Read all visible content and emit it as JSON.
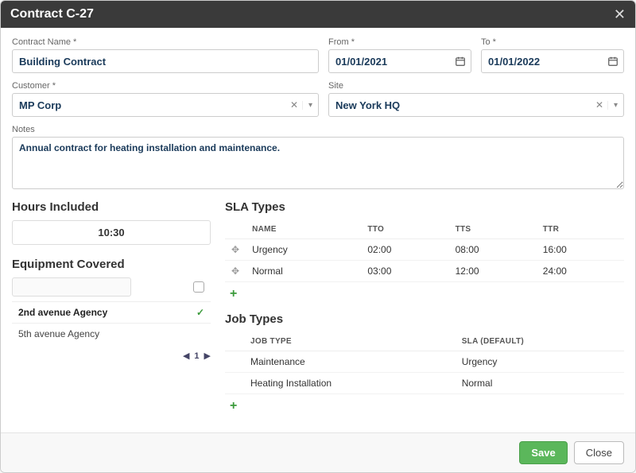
{
  "header": {
    "title": "Contract C-27"
  },
  "form": {
    "contract_name": {
      "label": "Contract Name *",
      "value": "Building Contract"
    },
    "from": {
      "label": "From *",
      "value": "01/01/2021"
    },
    "to": {
      "label": "To *",
      "value": "01/01/2022"
    },
    "customer": {
      "label": "Customer *",
      "value": "MP Corp"
    },
    "site": {
      "label": "Site",
      "value": "New York HQ"
    },
    "notes": {
      "label": "Notes",
      "value": "Annual contract for heating installation and maintenance."
    }
  },
  "hours": {
    "title": "Hours Included",
    "value": "10:30"
  },
  "equipment": {
    "title": "Equipment Covered",
    "items": [
      {
        "name": "2nd avenue Agency",
        "selected": true
      },
      {
        "name": "5th avenue Agency",
        "selected": false
      }
    ],
    "page": "1"
  },
  "sla": {
    "title": "SLA Types",
    "cols": {
      "name": "NAME",
      "tto": "TTO",
      "tts": "TTS",
      "ttr": "TTR"
    },
    "rows": [
      {
        "name": "Urgency",
        "tto": "02:00",
        "tts": "08:00",
        "ttr": "16:00"
      },
      {
        "name": "Normal",
        "tto": "03:00",
        "tts": "12:00",
        "ttr": "24:00"
      }
    ]
  },
  "job": {
    "title": "Job Types",
    "cols": {
      "type": "JOB TYPE",
      "sla": "SLA (DEFAULT)"
    },
    "rows": [
      {
        "type": "Maintenance",
        "sla": "Urgency"
      },
      {
        "type": "Heating Installation",
        "sla": "Normal"
      }
    ]
  },
  "footer": {
    "save": "Save",
    "close": "Close"
  }
}
